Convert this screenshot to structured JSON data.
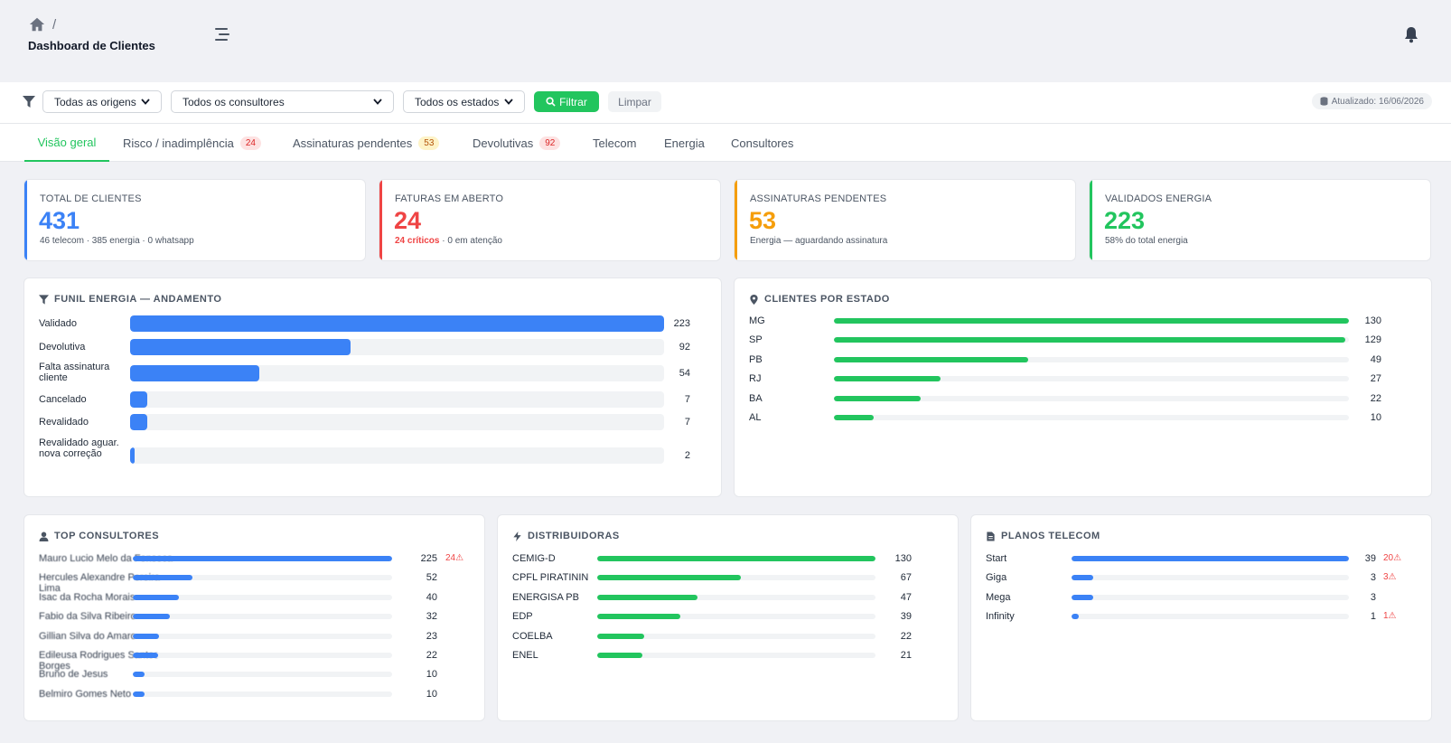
{
  "header": {
    "breadcrumb_sep": "/",
    "title": "Dashboard de Clientes"
  },
  "filters": {
    "origem": "Todas as origens",
    "consultor": "Todos os consultores",
    "estado": "Todos os estados",
    "filtrar_label": "Filtrar",
    "limpar_label": "Limpar",
    "updated": "Atualizado: 16/06/2026"
  },
  "tabs": [
    {
      "label": "Visão geral",
      "badge": ""
    },
    {
      "label": "Risco / inadimplência",
      "badge": "24"
    },
    {
      "label": "Assinaturas pendentes",
      "badge": "53"
    },
    {
      "label": "Devolutivas",
      "badge": "92"
    },
    {
      "label": "Telecom",
      "badge": ""
    },
    {
      "label": "Energia",
      "badge": ""
    },
    {
      "label": "Consultores",
      "badge": ""
    }
  ],
  "kpis": [
    {
      "label": "TOTAL DE CLIENTES",
      "value": "431",
      "sub": "46 telecom · 385 energia · 0 whatsapp",
      "sub_strong": "",
      "color": "#3b82f6"
    },
    {
      "label": "FATURAS EM ABERTO",
      "value": "24",
      "sub": " · 0 em atenção",
      "sub_strong": "24 críticos",
      "color": "#ef4444"
    },
    {
      "label": "ASSINATURAS PENDENTES",
      "value": "53",
      "sub": "Energia — aguardando assinatura",
      "sub_strong": "",
      "color": "#f59e0b"
    },
    {
      "label": "VALIDADOS ENERGIA",
      "value": "223",
      "sub": "58% do total energia",
      "sub_strong": "",
      "color": "#22c55e"
    }
  ],
  "funil": {
    "title": "FUNIL ENERGIA — ANDAMENTO",
    "max": 223,
    "items": [
      {
        "label": "Validado",
        "value": 223
      },
      {
        "label": "Devolutiva",
        "value": 92
      },
      {
        "label": "Falta assinatura cliente",
        "value": 54
      },
      {
        "label": "Cancelado",
        "value": 7
      },
      {
        "label": "Revalidado",
        "value": 7
      },
      {
        "label": "Revalidado aguar. nova correção",
        "value": 2
      }
    ]
  },
  "estados": {
    "title": "CLIENTES POR ESTADO",
    "max": 130,
    "items": [
      {
        "label": "MG",
        "value": 130
      },
      {
        "label": "SP",
        "value": 129
      },
      {
        "label": "PB",
        "value": 49
      },
      {
        "label": "RJ",
        "value": 27
      },
      {
        "label": "BA",
        "value": 22
      },
      {
        "label": "AL",
        "value": 10
      }
    ]
  },
  "consultores": {
    "title": "TOP CONSULTORES",
    "max": 225,
    "items": [
      {
        "label": "Mauro Lucio Melo da Fonseca",
        "value": 225,
        "warn": "24⚠"
      },
      {
        "label": "Hercules Alexandre Pereira Lima",
        "value": 52,
        "warn": ""
      },
      {
        "label": "Isac da Rocha Morais",
        "value": 40,
        "warn": ""
      },
      {
        "label": "Fabio da Silva Ribeiro",
        "value": 32,
        "warn": ""
      },
      {
        "label": "Gillian Silva do Amaro",
        "value": 23,
        "warn": ""
      },
      {
        "label": "Edileusa Rodrigues Santos Borges",
        "value": 22,
        "warn": ""
      },
      {
        "label": "Bruno de Jesus",
        "value": 10,
        "warn": ""
      },
      {
        "label": "Belmiro Gomes Neto",
        "value": 10,
        "warn": ""
      }
    ]
  },
  "distribuidoras": {
    "title": "DISTRIBUIDORAS",
    "max": 130,
    "items": [
      {
        "label": "CEMIG-D",
        "value": 130
      },
      {
        "label": "CPFL PIRATININ",
        "value": 67
      },
      {
        "label": "ENERGISA PB",
        "value": 47
      },
      {
        "label": "EDP",
        "value": 39
      },
      {
        "label": "COELBA",
        "value": 22
      },
      {
        "label": "ENEL",
        "value": 21
      }
    ]
  },
  "planos": {
    "title": "PLANOS TELECOM",
    "max": 39,
    "items": [
      {
        "label": "Start",
        "value": 39,
        "warn": "20⚠"
      },
      {
        "label": "Giga",
        "value": 3,
        "warn": "3⚠"
      },
      {
        "label": "Mega",
        "value": 3,
        "warn": ""
      },
      {
        "label": "Infinity",
        "value": 1,
        "warn": "1⚠"
      }
    ]
  },
  "colors": {
    "blue": "#3b82f6",
    "green": "#22c55e",
    "red": "#ef4444",
    "amber": "#f59e0b"
  }
}
